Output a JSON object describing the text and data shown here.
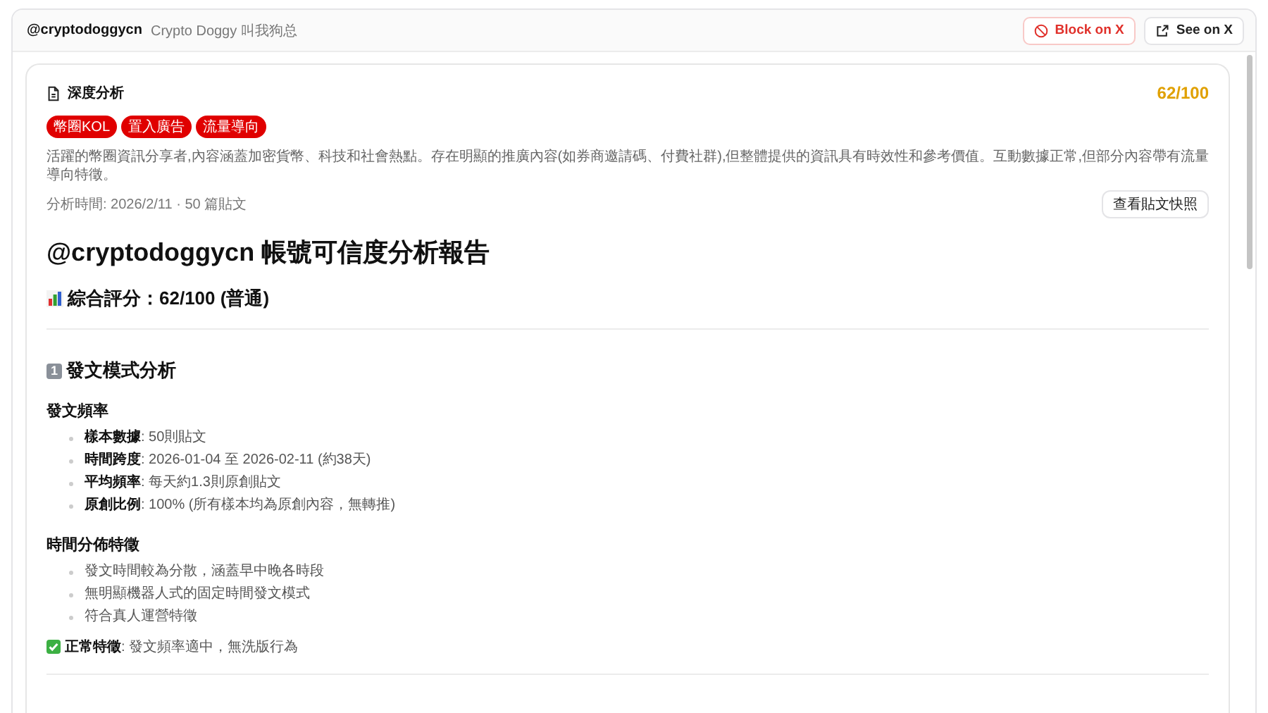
{
  "header": {
    "handle": "@cryptodoggycn",
    "display_name": "Crypto Doggy 叫我狗总",
    "buttons": [
      {
        "kind": "block",
        "label": "Block on X"
      },
      {
        "kind": "external",
        "label": "See on X"
      }
    ]
  },
  "analysis": {
    "title": "深度分析",
    "score": "62/100",
    "tags": [
      "幣圈KOL",
      "置入廣告",
      "流量導向"
    ],
    "summary": "活躍的幣圈資訊分享者,內容涵蓋加密貨幣、科技和社會熱點。存在明顯的推廣內容(如券商邀請碼、付費社群),但整體提供的資訊具有時效性和參考價值。互動數據正常,但部分內容帶有流量導向特徵。",
    "meta": "分析時間: 2026/2/11 · 50 篇貼文",
    "snapshot_button": "查看貼文快照"
  },
  "report": {
    "blocks": [
      {
        "kind": "title",
        "text": "@cryptodoggycn 帳號可信度分析報告"
      },
      {
        "kind": "score",
        "text": "綜合評分：62/100 (普通)"
      },
      {
        "kind": "rule"
      },
      {
        "kind": "section",
        "number": "1",
        "text": "發文模式分析"
      },
      {
        "kind": "subheading",
        "text": "發文頻率"
      },
      {
        "kind": "list",
        "items": [
          "**樣本數據**: 50則貼文",
          "**時間跨度**: 2026-01-04 至 2026-02-11 (約38天)",
          "**平均頻率**: 每天約1.3則原創貼文",
          "**原創比例**: 100% (所有樣本均為原創內容，無轉推)"
        ]
      },
      {
        "kind": "subheading",
        "text": "時間分佈特徵"
      },
      {
        "kind": "list",
        "items": [
          "發文時間較為分散，涵蓋早中晚各時段",
          "無明顯機器人式的固定時間發文模式",
          "符合真人運營特徵"
        ]
      },
      {
        "kind": "note",
        "text": "**正常特徵**: 發文頻率適中，無洗版行為"
      },
      {
        "kind": "rule"
      }
    ]
  }
}
